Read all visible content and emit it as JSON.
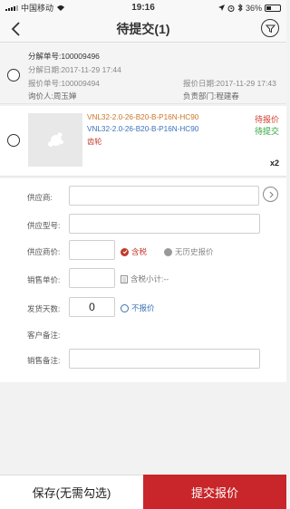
{
  "status_bar": {
    "carrier": "中国移动",
    "time": "19:16",
    "battery": "36%",
    "battery_level": 0.36
  },
  "nav": {
    "title": "待提交(1)"
  },
  "order": {
    "split_no": "分解单号:100009496",
    "split_date": "分解日期:2017-11-29 17:44",
    "quote_no": "报价单号:100009494",
    "quote_date": "报价日期:2017-11-29 17:43",
    "inquirer": "询价人:周玉婵",
    "department": "负责部门:程建春"
  },
  "product": {
    "model_primary": "VNL32-2.0-26-B20-B-P16N-HC90",
    "model_secondary": "VNL32-2.0-26-B20-B-P16N-HC90",
    "name": "齿轮",
    "status_quote": "待报价",
    "status_submit": "待提交",
    "quantity": "x2"
  },
  "form": {
    "supplier_label": "供应商:",
    "supplier_value": "",
    "supplier_model_label": "供应型号:",
    "supplier_model_value": "",
    "supplier_price_label": "供应商价:",
    "supplier_price_value": "",
    "tax_included": "含税",
    "no_history": "无历史报价",
    "sale_price_label": "销售单价:",
    "sale_price_value": "",
    "tax_subtotal": "含税小计:--",
    "ship_days_label": "发货天数:",
    "ship_days_value": "0",
    "no_quote": "不报价",
    "customer_note_label": "客户备注:",
    "sales_note_label": "销售备注:",
    "sales_note_value": ""
  },
  "footer": {
    "save_label": "保存(无需勾选)",
    "submit_label": "提交报价"
  }
}
